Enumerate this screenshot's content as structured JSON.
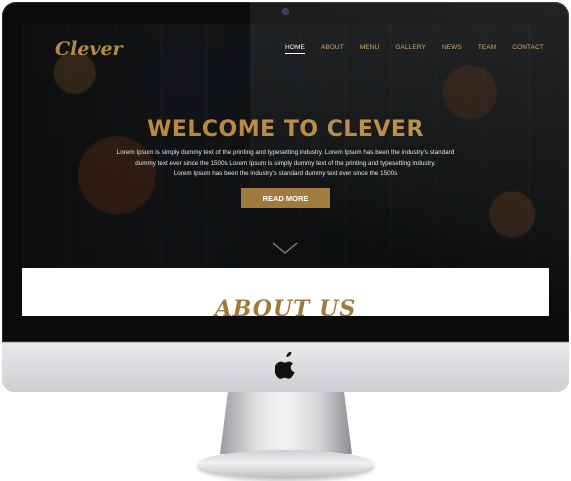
{
  "site": {
    "logo": "Clever",
    "nav": [
      {
        "label": "HOME",
        "active": true
      },
      {
        "label": "ABOUT",
        "active": false
      },
      {
        "label": "MENU",
        "active": false
      },
      {
        "label": "GALLERY",
        "active": false
      },
      {
        "label": "NEWS",
        "active": false
      },
      {
        "label": "TEAM",
        "active": false
      },
      {
        "label": "CONTACT",
        "active": false
      }
    ],
    "hero": {
      "title": "WELCOME TO CLEVER",
      "description": [
        "Lorem Ipsum is simply dummy text of the printing and typesetting industry. Lorem Ipsum has been the industry's standard",
        "dummy text ever since the 1500s Lorem Ipsum is simply dummy text of the printing and typesetting industry.",
        "Lorem Ipsum has been the industry's standard dummy text ever since the 1500s"
      ],
      "button_label": "READ MORE"
    },
    "about": {
      "title": "ABOUT US"
    }
  },
  "device": {
    "brand_icon": "apple-icon",
    "camera_icon": "camera-icon"
  },
  "colors": {
    "accent": "#b88a3e",
    "button": "#a07a3c",
    "hero_bg": "#161a1d",
    "bezel": "#0b0b0c"
  }
}
